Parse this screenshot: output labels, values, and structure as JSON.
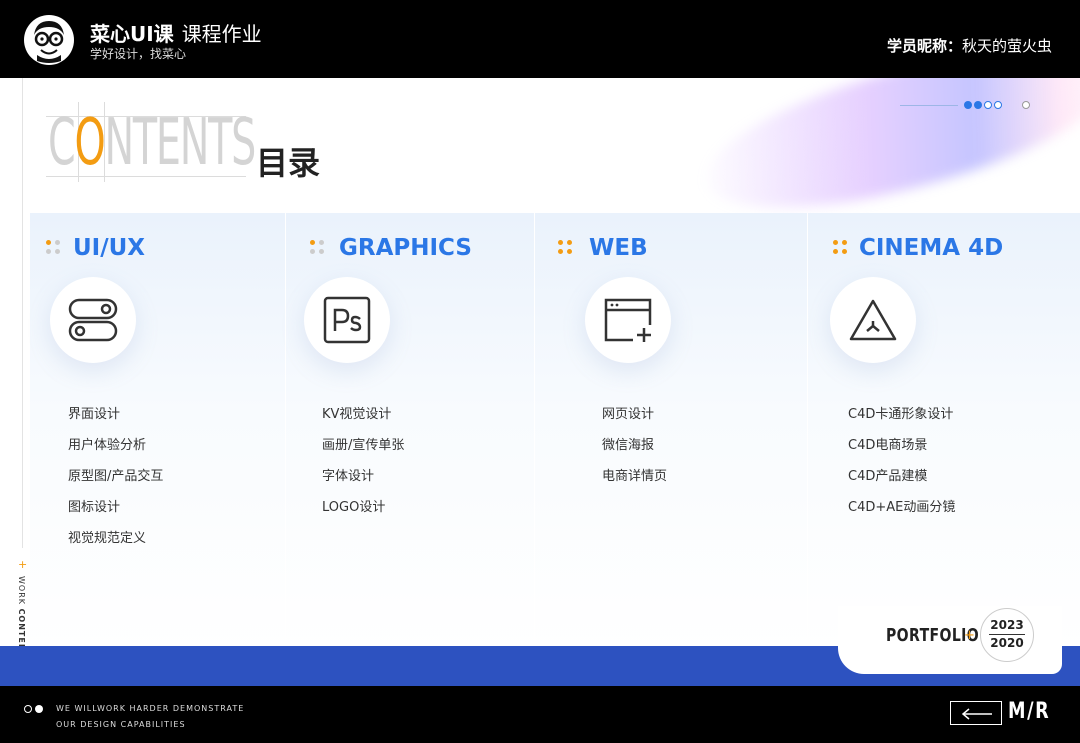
{
  "header": {
    "brand": "菜心UI课",
    "course": "课程作业",
    "slogan": "学好设计，找菜心",
    "student_label": "学员昵称：",
    "student_name": "秋天的萤火虫"
  },
  "title": {
    "word": "CONTENTS",
    "word_before": "C",
    "word_highlight": "O",
    "word_after": "NTENTS",
    "cn": "目录"
  },
  "pagination": {
    "total": 5,
    "active": 2
  },
  "columns": [
    {
      "title": "UI/UX",
      "icon": "toggle-switch-icon",
      "items": [
        "界面设计",
        "用户体验分析",
        "原型图/产品交互",
        "图标设计",
        "视觉规范定义"
      ]
    },
    {
      "title": "GRAPHICS",
      "icon": "photoshop-icon",
      "items": [
        "KV视觉设计",
        "画册/宣传单张",
        "字体设计",
        "LOGO设计"
      ]
    },
    {
      "title": "WEB",
      "icon": "browser-add-icon",
      "items": [
        "网页设计",
        "微信海报",
        "电商详情页"
      ]
    },
    {
      "title": "CINEMA 4D",
      "icon": "cinema4d-icon",
      "items": [
        "C4D卡通形象设计",
        "C4D电商场景",
        "C4D产品建模",
        "C4D+AE动画分镜"
      ]
    }
  ],
  "side": {
    "work": "WORK",
    "contents": "CONTENTS",
    "plus": "+"
  },
  "portfolio": {
    "label": "PORTFOLIO",
    "plus": "+",
    "year_top": "2023",
    "year_bottom": "2020"
  },
  "footer": {
    "line1": "WE WILLWORK HARDER DEMONSTRATE",
    "line2": "OUR DESIGN CAPABILITIES",
    "logo": "M/R"
  },
  "colors": {
    "accent_blue": "#2b77e6",
    "accent_orange": "#f39c12",
    "band_blue": "#2d52c0"
  }
}
